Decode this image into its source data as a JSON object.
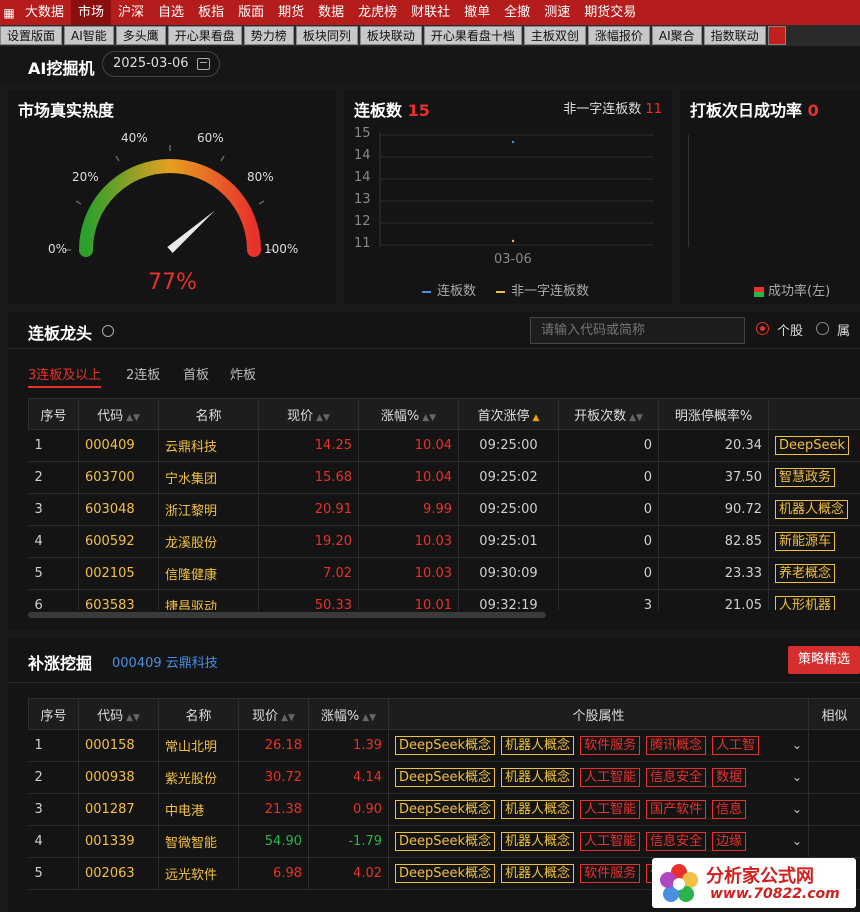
{
  "menu": {
    "items": [
      "大数据",
      "市场",
      "沪深",
      "自选",
      "板指",
      "版面",
      "期货",
      "数据",
      "龙虎榜",
      "财联社",
      "撤单",
      "全撤",
      "测速",
      "期货交易"
    ],
    "active_index": 1
  },
  "subtabs": [
    "设置版面",
    "AI智能",
    "多头鹰",
    "开心果看盘",
    "势力榜",
    "板块同列",
    "板块联动",
    "开心果看盘十档",
    "主板双创",
    "涨幅报价",
    "AI聚合",
    "指数联动"
  ],
  "header": {
    "title": "AI挖掘机",
    "date": "2025-03-06"
  },
  "heat": {
    "title": "市场真实热度",
    "value": "77%",
    "level": 0.77,
    "gauge_labels": [
      "0%",
      "20%",
      "40%",
      "60%",
      "80%",
      "100%"
    ]
  },
  "lianban": {
    "title": "连板数",
    "count": "15",
    "sub_label": "非一字连板数",
    "sub_count": "11",
    "chart_data": {
      "type": "line",
      "x": [
        "03-06"
      ],
      "series": [
        {
          "name": "连板数",
          "values": [
            15
          ],
          "color": "#4a90e2"
        },
        {
          "name": "非一字连板数",
          "values": [
            11
          ],
          "color": "#f0c046"
        }
      ],
      "ylim": [
        11,
        15
      ],
      "yticks": [
        "15",
        "14",
        "14",
        "13",
        "12",
        "11"
      ]
    }
  },
  "daban": {
    "title": "打板次日成功率",
    "value": "0",
    "legend": "成功率(左)"
  },
  "leader": {
    "title": "连板龙头",
    "search_placeholder": "请输入代码或简称",
    "radio1": "个股",
    "radio2": "属",
    "tabs": [
      "3连板及以上",
      "2连板",
      "首板",
      "炸板"
    ],
    "columns": [
      "序号",
      "代码",
      "名称",
      "现价",
      "涨幅%",
      "首次涨停",
      "开板次数",
      "明涨停概率%"
    ],
    "rows": [
      {
        "idx": "1",
        "code": "000409",
        "name": "云鼎科技",
        "price": "14.25",
        "chg": "10.04",
        "time": "09:25:00",
        "open": "0",
        "prob": "20.34",
        "tag": "DeepSeek",
        "tagc": "gold"
      },
      {
        "idx": "2",
        "code": "603700",
        "name": "宁水集团",
        "price": "15.68",
        "chg": "10.04",
        "time": "09:25:02",
        "open": "0",
        "prob": "37.50",
        "tag": "智慧政务",
        "tagc": "gold"
      },
      {
        "idx": "3",
        "code": "603048",
        "name": "浙江黎明",
        "price": "20.91",
        "chg": "9.99",
        "time": "09:25:00",
        "open": "0",
        "prob": "90.72",
        "tag": "机器人概念",
        "tagc": "gold"
      },
      {
        "idx": "4",
        "code": "600592",
        "name": "龙溪股份",
        "price": "19.20",
        "chg": "10.03",
        "time": "09:25:01",
        "open": "0",
        "prob": "82.85",
        "tag": "新能源车",
        "tagc": "gold"
      },
      {
        "idx": "5",
        "code": "002105",
        "name": "信隆健康",
        "price": "7.02",
        "chg": "10.03",
        "time": "09:30:09",
        "open": "0",
        "prob": "23.33",
        "tag": "养老概念",
        "tagc": "gold"
      },
      {
        "idx": "6",
        "code": "603583",
        "name": "捷昌驱动",
        "price": "50.33",
        "chg": "10.01",
        "time": "09:32:19",
        "open": "3",
        "prob": "21.05",
        "tag": "人形机器",
        "tagc": "gold"
      }
    ]
  },
  "buzhang": {
    "title": "补涨挖掘",
    "stock": "000409 云鼎科技",
    "strategy_button": "策略精选",
    "columns": [
      "序号",
      "代码",
      "名称",
      "现价",
      "涨幅%",
      "个股属性",
      "相似"
    ],
    "rows": [
      {
        "idx": "1",
        "code": "000158",
        "name": "常山北明",
        "price": "26.18",
        "chg": "1.39",
        "dir": "red",
        "tags": [
          [
            "DeepSeek概念",
            "gold"
          ],
          [
            "机器人概念",
            "gold"
          ],
          [
            "软件服务",
            "red"
          ],
          [
            "腾讯概念",
            "red"
          ],
          [
            "人工智",
            "red"
          ]
        ]
      },
      {
        "idx": "2",
        "code": "000938",
        "name": "紫光股份",
        "price": "30.72",
        "chg": "4.14",
        "dir": "red",
        "tags": [
          [
            "DeepSeek概念",
            "gold"
          ],
          [
            "机器人概念",
            "gold"
          ],
          [
            "人工智能",
            "red"
          ],
          [
            "信息安全",
            "red"
          ],
          [
            "数据",
            "red"
          ]
        ]
      },
      {
        "idx": "3",
        "code": "001287",
        "name": "中电港",
        "price": "21.38",
        "chg": "0.90",
        "dir": "red",
        "tags": [
          [
            "DeepSeek概念",
            "gold"
          ],
          [
            "机器人概念",
            "gold"
          ],
          [
            "人工智能",
            "red"
          ],
          [
            "国产软件",
            "red"
          ],
          [
            "信息",
            "red"
          ]
        ]
      },
      {
        "idx": "4",
        "code": "001339",
        "name": "智微智能",
        "price": "54.90",
        "chg": "-1.79",
        "dir": "green",
        "tags": [
          [
            "DeepSeek概念",
            "gold"
          ],
          [
            "机器人概念",
            "gold"
          ],
          [
            "人工智能",
            "red"
          ],
          [
            "信息安全",
            "red"
          ],
          [
            "边缘",
            "red"
          ]
        ]
      },
      {
        "idx": "5",
        "code": "002063",
        "name": "远光软件",
        "price": "6.98",
        "chg": "4.02",
        "dir": "red",
        "tags": [
          [
            "DeepSeek概念",
            "gold"
          ],
          [
            "机器人概念",
            "gold"
          ],
          [
            "软件服务",
            "red"
          ],
          [
            "信息安全",
            "red"
          ],
          [
            "",
            "red"
          ]
        ]
      }
    ]
  },
  "watermark": {
    "line1": "分析家公式网",
    "line2": "www.70822.com"
  },
  "colors": {
    "menu_bg": "#b51d1d",
    "up": "#e8312d",
    "down": "#2bb34a",
    "code": "#f0c046"
  }
}
